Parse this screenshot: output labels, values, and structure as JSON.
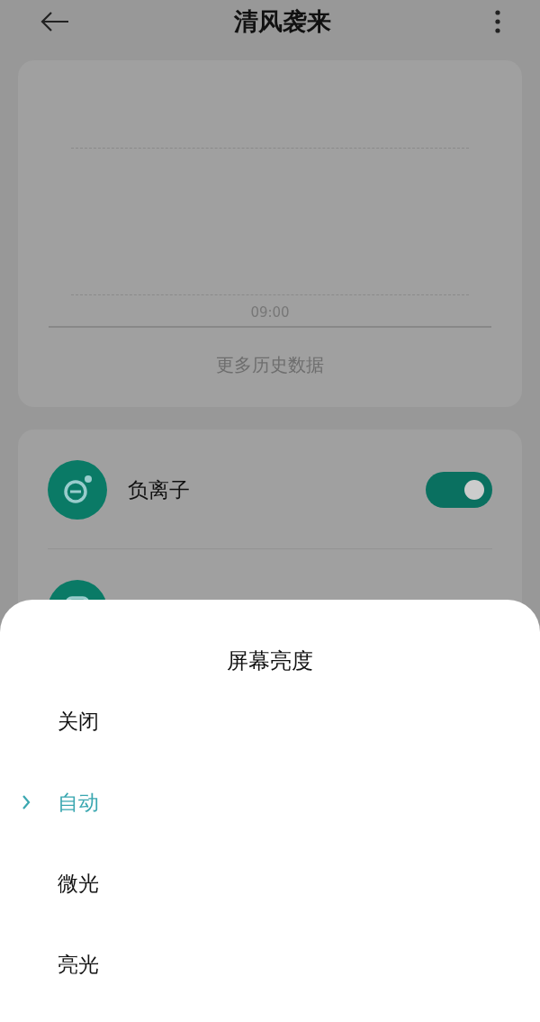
{
  "header": {
    "title": "清风袭来"
  },
  "history_card": {
    "time_label": "09:00",
    "more_link": "更多历史数据"
  },
  "controls": [
    {
      "kind": "toggle",
      "label": "负离子",
      "on": true
    },
    {
      "kind": "plain"
    }
  ],
  "sheet": {
    "title": "屏幕亮度",
    "options": [
      {
        "label": "关闭",
        "selected": false
      },
      {
        "label": "自动",
        "selected": true
      },
      {
        "label": "微光",
        "selected": false
      },
      {
        "label": "亮光",
        "selected": false
      }
    ]
  }
}
